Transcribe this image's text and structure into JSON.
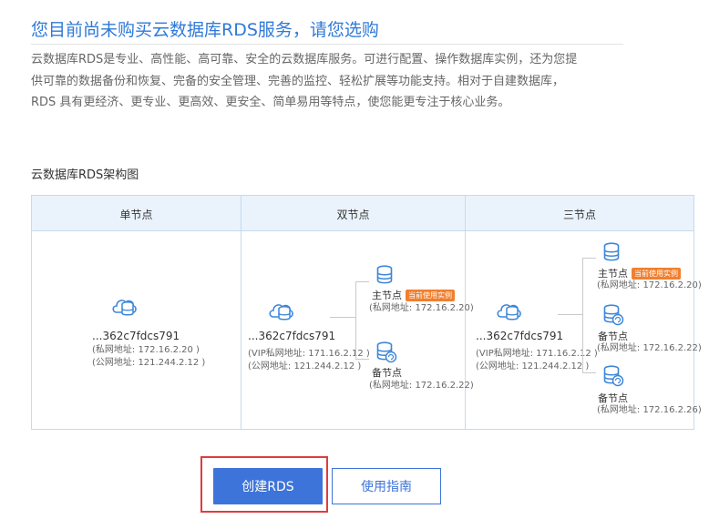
{
  "page": {
    "title": "您目前尚未购买云数据库RDS服务，请您选购",
    "description": "云数据库RDS是专业、高性能、高可靠、安全的云数据库服务。可进行配置、操作数据库实例，还为您提供可靠的数据备份和恢复、完备的安全管理、完善的监控、轻松扩展等功能支持。相对于自建数据库，RDS 具有更经济、更专业、更高效、更安全、简单易用等特点，使您能更专注于核心业务。",
    "arch_title": "云数据库RDS架构图"
  },
  "diagram": {
    "columns": [
      "单节点",
      "双节点",
      "三节点"
    ],
    "single": {
      "id": "...362c7fdcs791",
      "private": "(私网地址: 172.16.2.20 )",
      "public": "(公网地址: 121.244.2.12 )"
    },
    "double": {
      "id": "...362c7fdcs791",
      "vip": "(VIP私网地址: 171.16.2.12 )",
      "public": "(公网地址: 121.244.2.12 )",
      "primary_label": "主节点",
      "badge": "当前使用实例",
      "primary_addr": "(私网地址: 172.16.2.20)",
      "standby_label": "备节点",
      "standby_addr": "(私网地址: 172.16.2.22)"
    },
    "triple": {
      "id": "...362c7fdcs791",
      "vip": "(VIP私网地址: 171.16.2.12 )",
      "public": "(公网地址: 121.244.2.12 )",
      "primary_label": "主节点",
      "badge": "当前使用实例",
      "primary_addr": "(私网地址: 172.16.2.20)",
      "standby1_label": "备节点",
      "standby1_addr": "(私网地址: 172.16.2.22)",
      "standby2_label": "备节点",
      "standby2_addr": "(私网地址: 172.16.2.26)"
    }
  },
  "actions": {
    "create_label": "创建RDS",
    "guide_label": "使用指南"
  },
  "colors": {
    "accent": "#3d74d9",
    "title": "#2f7ad8",
    "badge": "#f17f2e",
    "highlight_border": "#e03c3c"
  }
}
